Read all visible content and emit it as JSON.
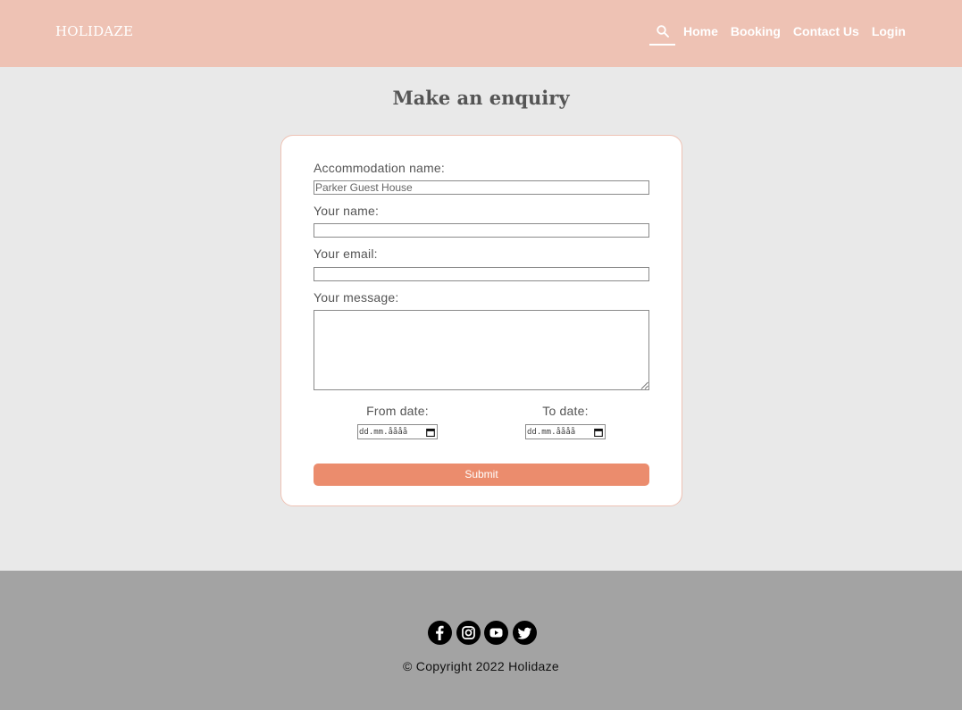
{
  "header": {
    "logo": "HOLIDAZE",
    "nav": {
      "search_icon": "search-icon",
      "links": [
        "Home",
        "Booking",
        "Contact Us",
        "Login"
      ]
    },
    "background": "#eec2b4"
  },
  "main": {
    "title": "Make an enquiry",
    "form": {
      "accommodation_label": "Accommodation name:",
      "accommodation_value": "Parker Guest House",
      "name_label": "Your name:",
      "name_value": "",
      "email_label": "Your email:",
      "email_value": "",
      "message_label": "Your message:",
      "message_value": "",
      "from_label": "From date:",
      "from_placeholder": "dd.mm.åååå",
      "to_label": "To date:",
      "to_placeholder": "dd.mm.åååå",
      "submit_label": "Submit"
    },
    "accent": "#eb8c6d"
  },
  "footer": {
    "socials": [
      "facebook-icon",
      "instagram-icon",
      "youtube-icon",
      "twitter-icon"
    ],
    "copyright": "© Copyright 2022 Holidaze",
    "background": "#a3a3a3"
  }
}
